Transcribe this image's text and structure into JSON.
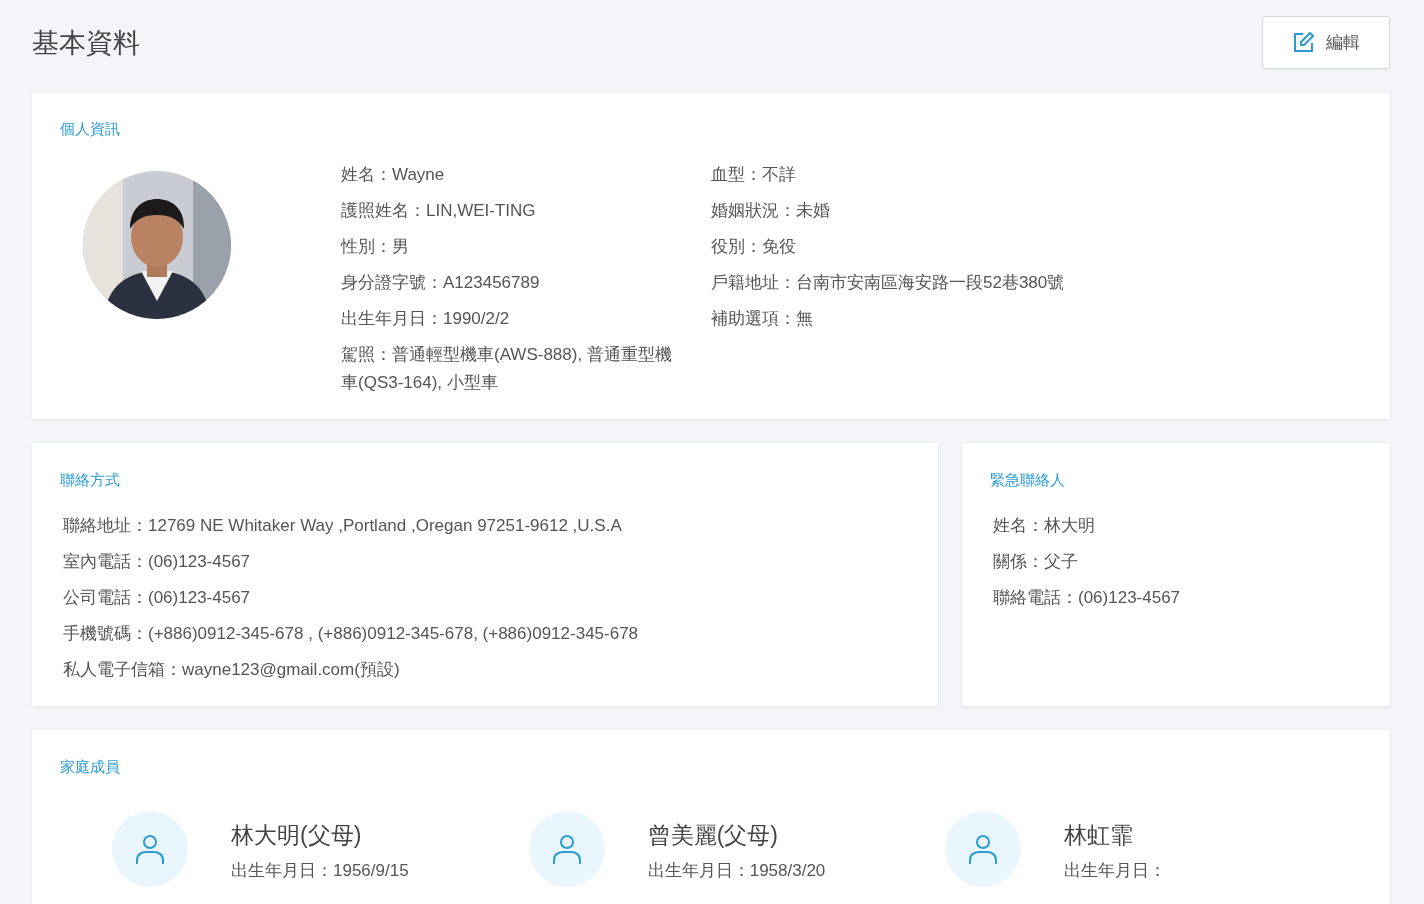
{
  "header": {
    "title": "基本資料",
    "edit_button": "編輯"
  },
  "personal_info": {
    "heading": "個人資訊",
    "photo": {
      "kind": "picture"
    },
    "left_fields": [
      "姓名：Wayne",
      "護照姓名：LIN,WEI-TING",
      "性別：男",
      "身分證字號：A123456789",
      "出生年月日：1990/2/2",
      "駕照：普通輕型機車(AWS-888), 普通重型機車(QS3-164), 小型車"
    ],
    "right_fields": [
      "血型：不詳",
      "婚姻狀況：未婚",
      "役別：免役",
      "戶籍地址：台南市安南區海安路一段52巷380號",
      "補助選項：無"
    ]
  },
  "contact": {
    "heading": "聯絡方式",
    "fields": [
      "聯絡地址：12769 NE Whitaker Way ,Portland ,Oregan 97251-9612 ,U.S.A",
      "室內電話：(06)123-4567",
      "公司電話：(06)123-4567",
      "手機號碼：(+886)0912-345-678 , (+886)0912-345-678,  (+886)0912-345-678",
      "私人電子信箱：wayne123@gmail.com(預設)"
    ]
  },
  "emergency_contact": {
    "heading": "緊急聯絡人",
    "fields": [
      "姓名：林大明",
      "關係：父子",
      "聯絡電話：(06)123-4567"
    ]
  },
  "family": {
    "heading": "家庭成員",
    "members": [
      {
        "name": "林大明(父母)",
        "birth": "出生年月日：1956/9/15"
      },
      {
        "name": "曾美麗(父母)",
        "birth": "出生年月日：1958/3/20"
      },
      {
        "name": "林虹霏",
        "birth": "出生年月日："
      }
    ]
  }
}
